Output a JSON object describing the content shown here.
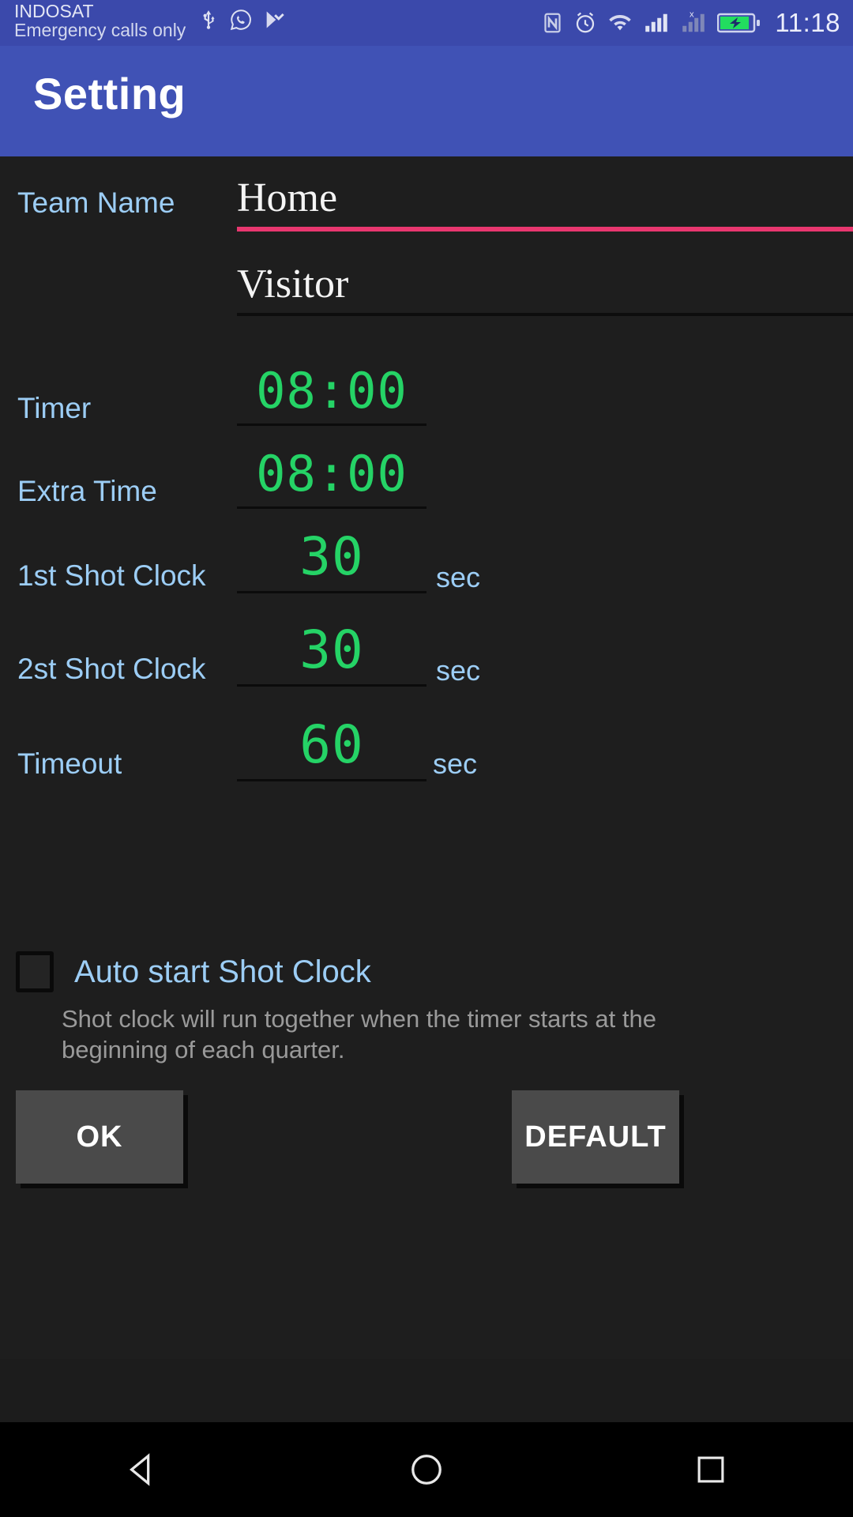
{
  "status_bar": {
    "carrier": "INDOSAT",
    "carrier_sub": "Emergency calls only",
    "time": "11:18",
    "left_icons": [
      "usb-icon",
      "whatsapp-icon",
      "play-badge-icon"
    ],
    "right_icons": [
      "nfc-icon",
      "alarm-icon",
      "wifi-icon",
      "signal-bars-icon",
      "signal-bars-no-service-icon",
      "battery-charging-icon"
    ],
    "background_color": "#3b49ab"
  },
  "appbar": {
    "title": "Setting",
    "background_color": "#4052b5"
  },
  "form": {
    "team_name_label": "Team Name",
    "home_team": {
      "value": "Home",
      "underline_color": "#e8376f"
    },
    "visitor_team": {
      "value": "Visitor",
      "underline_color": "#0d0d0d"
    },
    "rows": [
      {
        "label": "Timer",
        "value": "08:00",
        "unit": ""
      },
      {
        "label": "Extra Time",
        "value": "08:00",
        "unit": ""
      },
      {
        "label": "1st Shot Clock",
        "value": "30",
        "unit": "sec"
      },
      {
        "label": "2st Shot Clock",
        "value": "30",
        "unit": "sec"
      },
      {
        "label": "Timeout",
        "value": "60",
        "unit": "sec"
      }
    ],
    "auto_start": {
      "label": "Auto start Shot Clock",
      "checked": false,
      "description": "Shot clock will run together when the timer starts at the beginning of each quarter."
    }
  },
  "buttons": {
    "ok": "OK",
    "default": "DEFAULT"
  },
  "navbar": {
    "back": "back-triangle-icon",
    "home": "home-circle-icon",
    "recents": "recents-square-icon"
  },
  "colors": {
    "accent_blue": "#4052b5",
    "label_blue": "#9ccdf5",
    "lcd_green": "#25d366",
    "pink_underline": "#e8376f",
    "background": "#1e1e1e"
  }
}
